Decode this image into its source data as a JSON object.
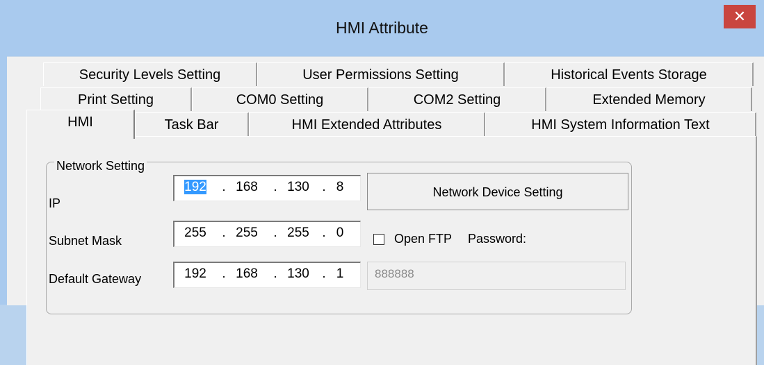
{
  "window": {
    "title": "HMI Attribute",
    "close_glyph": "✕"
  },
  "tabs": {
    "row1": [
      "Security Levels Setting",
      "User Permissions Setting",
      "Historical Events Storage"
    ],
    "row2": [
      "Print Setting",
      "COM0 Setting",
      "COM2 Setting",
      "Extended Memory"
    ],
    "row3": [
      "HMI",
      "Task Bar",
      "HMI Extended Attributes",
      "HMI System Information Text"
    ],
    "active": "HMI"
  },
  "network": {
    "group_title": "Network Setting",
    "ip_label": "IP",
    "ip": [
      "192",
      "168",
      "130",
      "8"
    ],
    "subnet_label": "Subnet Mask",
    "subnet": [
      "255",
      "255",
      "255",
      "0"
    ],
    "gateway_label": "Default Gateway",
    "gateway": [
      "192",
      "168",
      "130",
      "1"
    ],
    "dot": ".",
    "device_button": "Network Device Setting",
    "open_ftp_label": "Open FTP",
    "password_label": "Password:",
    "password_value": "888888"
  },
  "colors": {
    "titlebar": "#a9caee",
    "close": "#c9453f",
    "selection": "#3399ff"
  }
}
